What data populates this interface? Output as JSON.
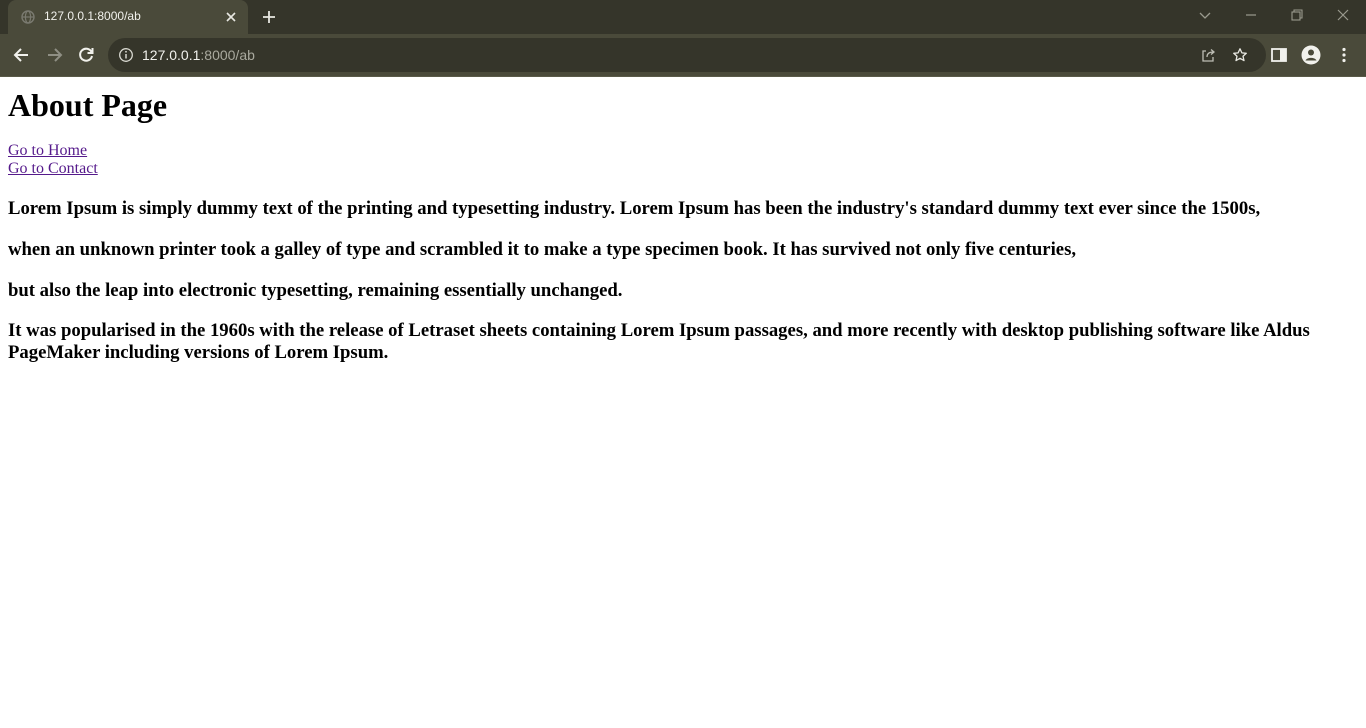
{
  "browser": {
    "tab": {
      "title": "127.0.0.1:8000/ab"
    },
    "address": {
      "host": "127.0.0.1",
      "path": ":8000/ab"
    }
  },
  "page": {
    "heading": "About Page",
    "links": {
      "home": "Go to Home",
      "contact": "Go to Contact"
    },
    "paragraphs": [
      "Lorem Ipsum is simply dummy text of the printing and typesetting industry. Lorem Ipsum has been the industry's standard dummy text ever since the 1500s,",
      "when an unknown printer took a galley of type and scrambled it to make a type specimen book. It has survived not only five centuries,",
      "but also the leap into electronic typesetting, remaining essentially unchanged.",
      "It was popularised in the 1960s with the release of Letraset sheets containing Lorem Ipsum passages, and more recently with desktop publishing software like Aldus PageMaker including versions of Lorem Ipsum."
    ]
  },
  "icons": {
    "favicon": "globe-icon",
    "tab_close": "close-icon",
    "new_tab": "plus-icon",
    "back": "arrow-left-icon",
    "forward": "arrow-right-icon",
    "reload": "reload-icon",
    "site_info": "info-icon",
    "share": "share-icon",
    "bookmark": "star-icon",
    "side_panel": "side-panel-icon",
    "profile": "profile-icon",
    "menu": "kebab-menu-icon"
  },
  "colors": {
    "chrome_dark": "#35352a",
    "chrome_light": "#4a4a3a",
    "link_visited": "#551a8b"
  }
}
